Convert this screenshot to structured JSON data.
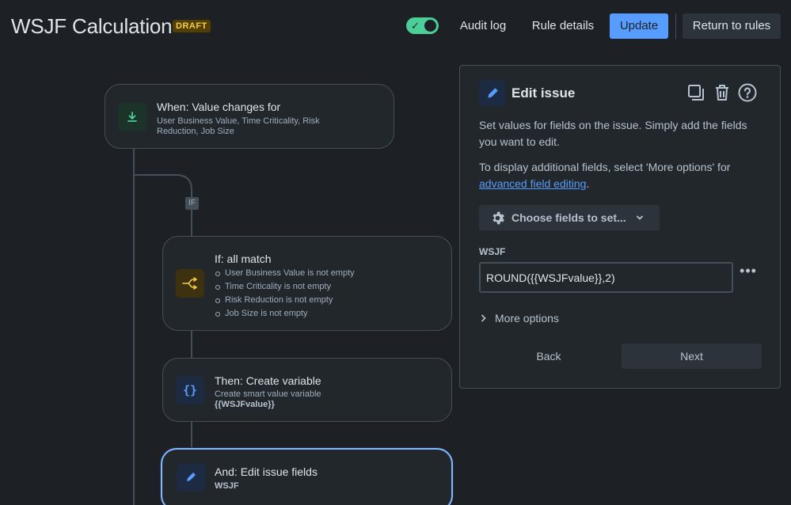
{
  "header": {
    "title": "WSJF Calculation",
    "status_badge": "DRAFT",
    "toggle_enabled": true,
    "audit_log_label": "Audit log",
    "rule_details_label": "Rule details",
    "update_label": "Update",
    "return_label": "Return to rules"
  },
  "flow": {
    "if_badge": "IF",
    "trigger": {
      "title": "When: Value changes for",
      "subtitle_line1": "User Business Value, Time Criticality, Risk",
      "subtitle_line2": "Reduction, Job Size",
      "icon": "trigger-icon"
    },
    "condition": {
      "title": "If: all match",
      "items": [
        "User Business Value is not empty",
        "Time Criticality is not empty",
        "Risk Reduction is not empty",
        "Job Size is not empty"
      ],
      "icon": "branch-icon"
    },
    "variable": {
      "title": "Then: Create variable",
      "subtitle": "Create smart value variable",
      "value": "{{WSJFvalue}}",
      "icon": "curly-braces-icon"
    },
    "edit": {
      "title": "And: Edit issue fields",
      "subtitle": "WSJF",
      "icon": "pencil-icon"
    }
  },
  "panel": {
    "title": "Edit issue",
    "desc1": "Set values for fields on the issue. Simply add the fields you want to edit.",
    "desc2_prefix": "To display additional fields, select 'More options' for ",
    "desc2_link": "advanced field editing",
    "desc2_suffix": ".",
    "choose_fields_label": "Choose fields to set...",
    "field_label": "WSJF",
    "field_value": "ROUND({{WSJFvalue}},2)",
    "more_options_label": "More options",
    "back_label": "Back",
    "next_label": "Next"
  },
  "colors": {
    "background": "#1d2125",
    "accent": "#579dff",
    "toggle_on": "#4bce97",
    "draft_bg": "#533f04",
    "draft_text": "#f5cd47"
  }
}
